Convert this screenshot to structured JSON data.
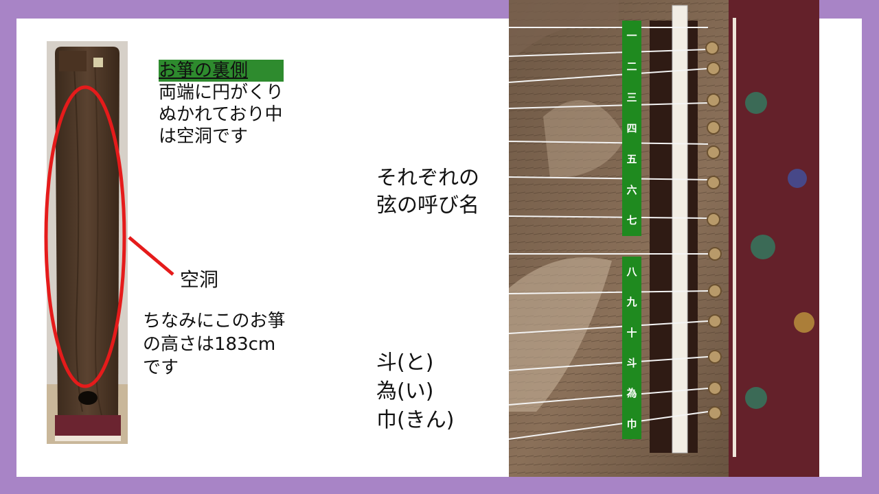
{
  "left_panel": {
    "back_heading": "お箏の裏側",
    "back_desc_lines": [
      "両端に円がくり",
      "ぬかれており中",
      "は空洞です"
    ],
    "hollow_label": "空洞",
    "height_lines": [
      "ちなみにこのお箏",
      "の高さは183cm",
      "です"
    ]
  },
  "middle_panel": {
    "string_names_title_lines": [
      "それぞれの",
      "弦の呼び名"
    ],
    "extra_strings": [
      "斗(と)",
      "為(い)",
      "巾(きん)"
    ]
  },
  "string_labels_top": [
    "一",
    "二",
    "三",
    "四",
    "五",
    "六",
    "七"
  ],
  "string_labels_bottom": [
    "八",
    "九",
    "十",
    "斗",
    "為",
    "巾"
  ],
  "colors": {
    "background_frame": "#a884c6",
    "label_green": "#1f8a1f",
    "highlight_green": "#2e8b2e",
    "ellipse_red": "#e51b1b"
  }
}
